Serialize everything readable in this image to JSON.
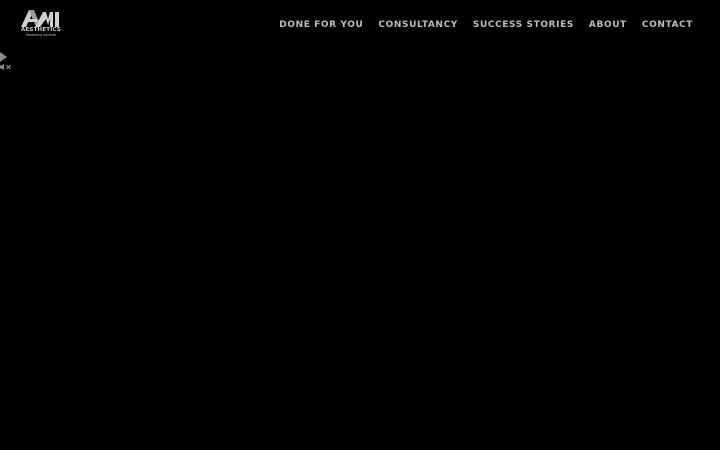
{
  "logo": {
    "mark": "AMI",
    "name": "AESTHETICS",
    "tagline": "Marketing Institute"
  },
  "nav": {
    "items": [
      {
        "label": "DONE FOR YOU"
      },
      {
        "label": "CONSULTANCY"
      },
      {
        "label": "SUCCESS STORIES"
      },
      {
        "label": "ABOUT"
      },
      {
        "label": "CONTACT"
      }
    ]
  },
  "controls": {
    "play_icon": "play-icon",
    "mute_icon": "speaker-muted-icon"
  },
  "colors": {
    "background": "#000000",
    "nav_text": "#bdbdbd",
    "logo": "#cfcfcf"
  }
}
